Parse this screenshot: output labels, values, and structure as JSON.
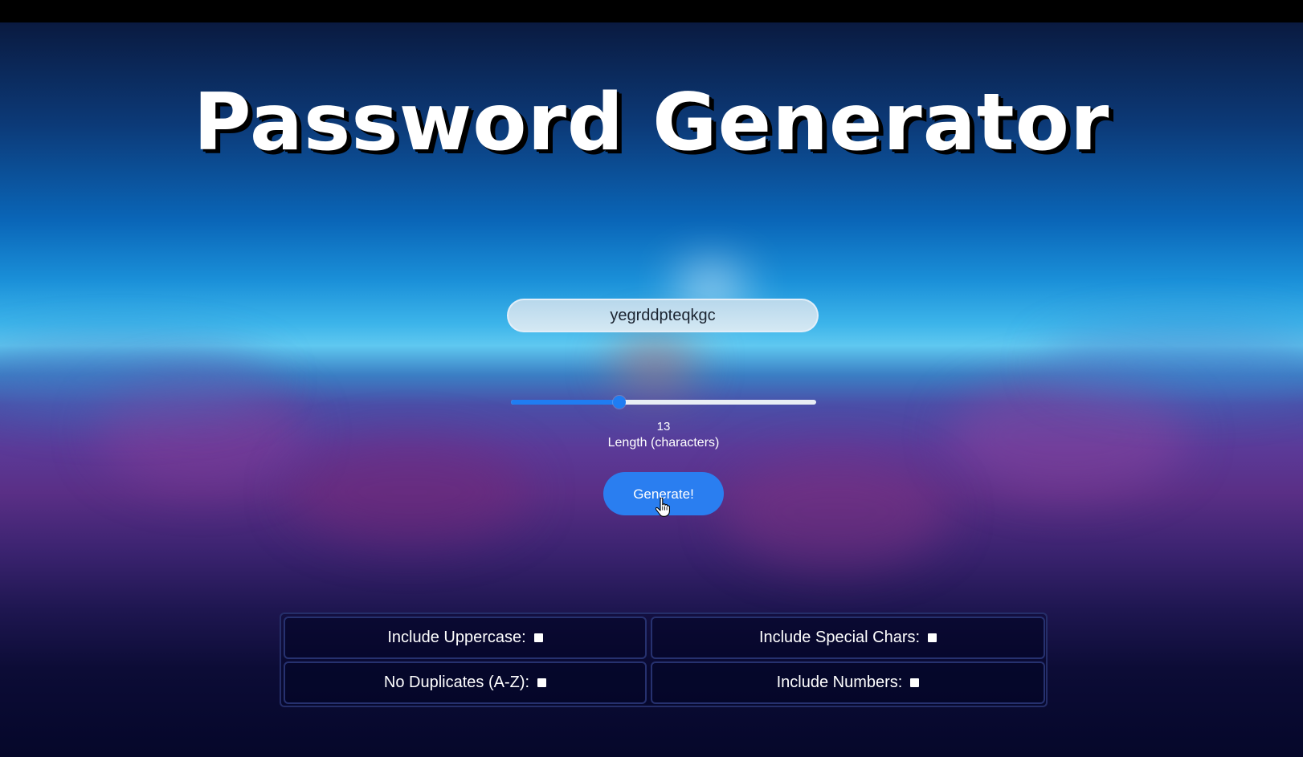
{
  "header": {
    "title": "Password Generator"
  },
  "password": {
    "value": "yegrddpteqkgc"
  },
  "length": {
    "value": "13",
    "label": "Length (characters)",
    "slider_fraction": 0.355
  },
  "generate": {
    "label": "Generate!"
  },
  "options": {
    "uppercase": {
      "label": "Include Uppercase:",
      "checked": false
    },
    "special": {
      "label": "Include Special Chars:",
      "checked": false
    },
    "no_duplicates": {
      "label": "No Duplicates (A-Z):",
      "checked": false
    },
    "numbers": {
      "label": "Include Numbers:",
      "checked": false
    }
  },
  "colors": {
    "accent": "#2a7ef0",
    "text": "#ffffff"
  },
  "icons": {
    "cursor": "hand-pointer-icon"
  }
}
